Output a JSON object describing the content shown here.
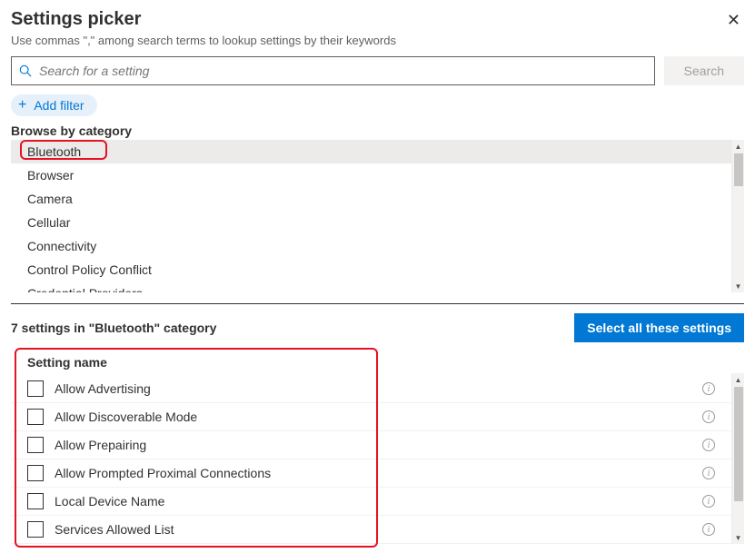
{
  "header": {
    "title": "Settings picker",
    "subtitle": "Use commas \",\" among search terms to lookup settings by their keywords"
  },
  "search": {
    "placeholder": "Search for a setting",
    "button_label": "Search"
  },
  "filter": {
    "add_label": "Add filter"
  },
  "categories": {
    "label": "Browse by category",
    "items": [
      {
        "label": "Bluetooth",
        "selected": true
      },
      {
        "label": "Browser",
        "selected": false
      },
      {
        "label": "Camera",
        "selected": false
      },
      {
        "label": "Cellular",
        "selected": false
      },
      {
        "label": "Connectivity",
        "selected": false
      },
      {
        "label": "Control Policy Conflict",
        "selected": false
      },
      {
        "label": "Credential Providers",
        "selected": false
      }
    ]
  },
  "results": {
    "count_text": "7 settings in \"Bluetooth\" category",
    "select_all_label": "Select all these settings",
    "column_header": "Setting name",
    "items": [
      {
        "name": "Allow Advertising"
      },
      {
        "name": "Allow Discoverable Mode"
      },
      {
        "name": "Allow Prepairing"
      },
      {
        "name": "Allow Prompted Proximal Connections"
      },
      {
        "name": "Local Device Name"
      },
      {
        "name": "Services Allowed List"
      }
    ]
  }
}
